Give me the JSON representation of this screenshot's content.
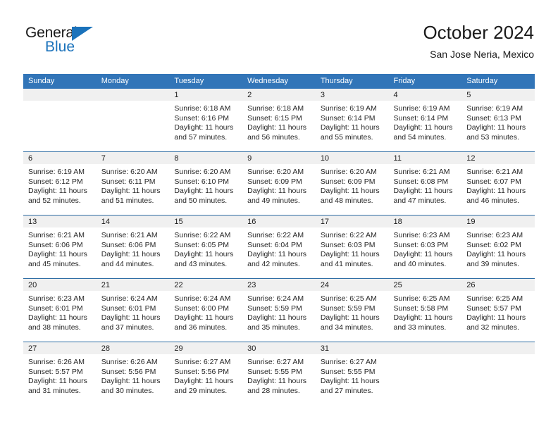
{
  "brand": {
    "name_part1": "General",
    "name_part2": "Blue",
    "triangle_icon": "triangle-icon",
    "color_primary": "#1a72bb",
    "color_text": "#1a1a1a"
  },
  "header": {
    "title": "October 2024",
    "subtitle": "San Jose Neria, Mexico"
  },
  "theme": {
    "header_blue": "#3275b8",
    "separator_blue": "#2e6da4",
    "band_gray": "#f0f0f0"
  },
  "weekday_headers": [
    "Sunday",
    "Monday",
    "Tuesday",
    "Wednesday",
    "Thursday",
    "Friday",
    "Saturday"
  ],
  "labels": {
    "sunrise_prefix": "Sunrise:",
    "sunset_prefix": "Sunset:",
    "daylight_prefix": "Daylight:"
  },
  "weeks": [
    [
      {
        "day": "",
        "empty": true
      },
      {
        "day": "",
        "empty": true
      },
      {
        "day": "1",
        "sunrise": "Sunrise: 6:18 AM",
        "sunset": "Sunset: 6:16 PM",
        "daylight": "Daylight: 11 hours and 57 minutes."
      },
      {
        "day": "2",
        "sunrise": "Sunrise: 6:18 AM",
        "sunset": "Sunset: 6:15 PM",
        "daylight": "Daylight: 11 hours and 56 minutes."
      },
      {
        "day": "3",
        "sunrise": "Sunrise: 6:19 AM",
        "sunset": "Sunset: 6:14 PM",
        "daylight": "Daylight: 11 hours and 55 minutes."
      },
      {
        "day": "4",
        "sunrise": "Sunrise: 6:19 AM",
        "sunset": "Sunset: 6:14 PM",
        "daylight": "Daylight: 11 hours and 54 minutes."
      },
      {
        "day": "5",
        "sunrise": "Sunrise: 6:19 AM",
        "sunset": "Sunset: 6:13 PM",
        "daylight": "Daylight: 11 hours and 53 minutes."
      }
    ],
    [
      {
        "day": "6",
        "sunrise": "Sunrise: 6:19 AM",
        "sunset": "Sunset: 6:12 PM",
        "daylight": "Daylight: 11 hours and 52 minutes."
      },
      {
        "day": "7",
        "sunrise": "Sunrise: 6:20 AM",
        "sunset": "Sunset: 6:11 PM",
        "daylight": "Daylight: 11 hours and 51 minutes."
      },
      {
        "day": "8",
        "sunrise": "Sunrise: 6:20 AM",
        "sunset": "Sunset: 6:10 PM",
        "daylight": "Daylight: 11 hours and 50 minutes."
      },
      {
        "day": "9",
        "sunrise": "Sunrise: 6:20 AM",
        "sunset": "Sunset: 6:09 PM",
        "daylight": "Daylight: 11 hours and 49 minutes."
      },
      {
        "day": "10",
        "sunrise": "Sunrise: 6:20 AM",
        "sunset": "Sunset: 6:09 PM",
        "daylight": "Daylight: 11 hours and 48 minutes."
      },
      {
        "day": "11",
        "sunrise": "Sunrise: 6:21 AM",
        "sunset": "Sunset: 6:08 PM",
        "daylight": "Daylight: 11 hours and 47 minutes."
      },
      {
        "day": "12",
        "sunrise": "Sunrise: 6:21 AM",
        "sunset": "Sunset: 6:07 PM",
        "daylight": "Daylight: 11 hours and 46 minutes."
      }
    ],
    [
      {
        "day": "13",
        "sunrise": "Sunrise: 6:21 AM",
        "sunset": "Sunset: 6:06 PM",
        "daylight": "Daylight: 11 hours and 45 minutes."
      },
      {
        "day": "14",
        "sunrise": "Sunrise: 6:21 AM",
        "sunset": "Sunset: 6:06 PM",
        "daylight": "Daylight: 11 hours and 44 minutes."
      },
      {
        "day": "15",
        "sunrise": "Sunrise: 6:22 AM",
        "sunset": "Sunset: 6:05 PM",
        "daylight": "Daylight: 11 hours and 43 minutes."
      },
      {
        "day": "16",
        "sunrise": "Sunrise: 6:22 AM",
        "sunset": "Sunset: 6:04 PM",
        "daylight": "Daylight: 11 hours and 42 minutes."
      },
      {
        "day": "17",
        "sunrise": "Sunrise: 6:22 AM",
        "sunset": "Sunset: 6:03 PM",
        "daylight": "Daylight: 11 hours and 41 minutes."
      },
      {
        "day": "18",
        "sunrise": "Sunrise: 6:23 AM",
        "sunset": "Sunset: 6:03 PM",
        "daylight": "Daylight: 11 hours and 40 minutes."
      },
      {
        "day": "19",
        "sunrise": "Sunrise: 6:23 AM",
        "sunset": "Sunset: 6:02 PM",
        "daylight": "Daylight: 11 hours and 39 minutes."
      }
    ],
    [
      {
        "day": "20",
        "sunrise": "Sunrise: 6:23 AM",
        "sunset": "Sunset: 6:01 PM",
        "daylight": "Daylight: 11 hours and 38 minutes."
      },
      {
        "day": "21",
        "sunrise": "Sunrise: 6:24 AM",
        "sunset": "Sunset: 6:01 PM",
        "daylight": "Daylight: 11 hours and 37 minutes."
      },
      {
        "day": "22",
        "sunrise": "Sunrise: 6:24 AM",
        "sunset": "Sunset: 6:00 PM",
        "daylight": "Daylight: 11 hours and 36 minutes."
      },
      {
        "day": "23",
        "sunrise": "Sunrise: 6:24 AM",
        "sunset": "Sunset: 5:59 PM",
        "daylight": "Daylight: 11 hours and 35 minutes."
      },
      {
        "day": "24",
        "sunrise": "Sunrise: 6:25 AM",
        "sunset": "Sunset: 5:59 PM",
        "daylight": "Daylight: 11 hours and 34 minutes."
      },
      {
        "day": "25",
        "sunrise": "Sunrise: 6:25 AM",
        "sunset": "Sunset: 5:58 PM",
        "daylight": "Daylight: 11 hours and 33 minutes."
      },
      {
        "day": "26",
        "sunrise": "Sunrise: 6:25 AM",
        "sunset": "Sunset: 5:57 PM",
        "daylight": "Daylight: 11 hours and 32 minutes."
      }
    ],
    [
      {
        "day": "27",
        "sunrise": "Sunrise: 6:26 AM",
        "sunset": "Sunset: 5:57 PM",
        "daylight": "Daylight: 11 hours and 31 minutes."
      },
      {
        "day": "28",
        "sunrise": "Sunrise: 6:26 AM",
        "sunset": "Sunset: 5:56 PM",
        "daylight": "Daylight: 11 hours and 30 minutes."
      },
      {
        "day": "29",
        "sunrise": "Sunrise: 6:27 AM",
        "sunset": "Sunset: 5:56 PM",
        "daylight": "Daylight: 11 hours and 29 minutes."
      },
      {
        "day": "30",
        "sunrise": "Sunrise: 6:27 AM",
        "sunset": "Sunset: 5:55 PM",
        "daylight": "Daylight: 11 hours and 28 minutes."
      },
      {
        "day": "31",
        "sunrise": "Sunrise: 6:27 AM",
        "sunset": "Sunset: 5:55 PM",
        "daylight": "Daylight: 11 hours and 27 minutes."
      },
      {
        "day": "",
        "empty": true
      },
      {
        "day": "",
        "empty": true
      }
    ]
  ]
}
